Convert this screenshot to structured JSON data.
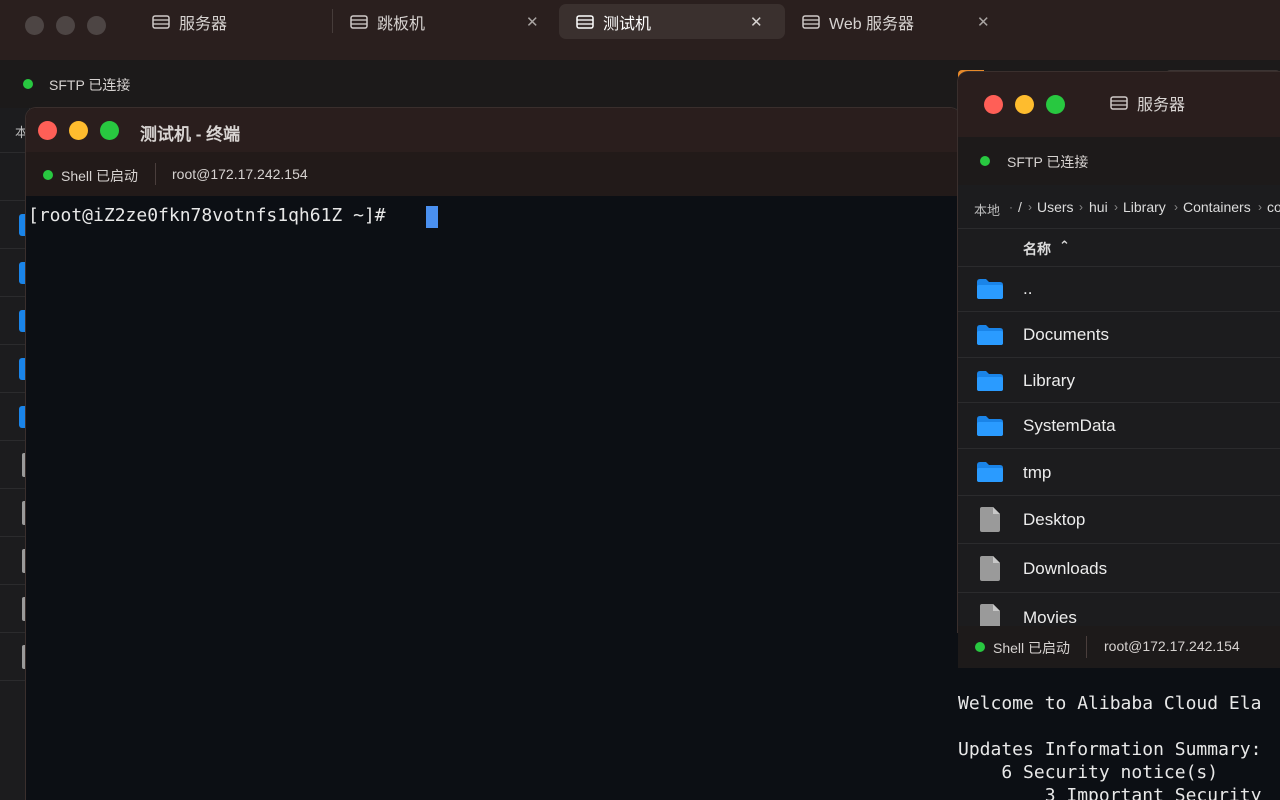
{
  "main_window": {
    "tabs": [
      {
        "label": "服务器",
        "icon": "server-icon",
        "active": false
      },
      {
        "label": "跳板机",
        "icon": "server-icon",
        "active": false
      },
      {
        "label": "测试机",
        "icon": "server-icon",
        "active": true
      },
      {
        "label": "Web 服务器",
        "icon": "server-icon",
        "active": false
      }
    ],
    "close_glyph": "✕",
    "sftp_status": "SFTP 已连接",
    "left_panel_local": "本"
  },
  "terminal": {
    "title": "测试机 - 终端",
    "shell_status": "Shell 已启动",
    "host": "root@172.17.242.154",
    "prompt": "[root@iZ2ze0fkn78votnfs1qh61Z ~]# "
  },
  "file_manager": {
    "title": "服务器",
    "sftp_status": "SFTP 已连接",
    "breadcrumb": [
      "本地",
      "/",
      "Users",
      "hui",
      "Library",
      "Containers",
      "co"
    ],
    "column_name": "名称",
    "sort_glyph": "⌃",
    "items": [
      {
        "name": "..",
        "type": "folder"
      },
      {
        "name": "Documents",
        "type": "folder"
      },
      {
        "name": "Library",
        "type": "folder"
      },
      {
        "name": "SystemData",
        "type": "folder"
      },
      {
        "name": "tmp",
        "type": "folder"
      },
      {
        "name": "Desktop",
        "type": "file"
      },
      {
        "name": "Downloads",
        "type": "file"
      },
      {
        "name": "Movies",
        "type": "file"
      }
    ]
  },
  "bottom_terminal": {
    "shell_status": "Shell 已启动",
    "host": "root@172.17.242.154",
    "lines": [
      "Welcome to Alibaba Cloud Ela",
      "",
      "Updates Information Summary:",
      "    6 Security notice(s)",
      "        3 Important Security"
    ]
  },
  "colors": {
    "status_green": "#28c840",
    "folder_blue": "#1a84e8",
    "cursor_blue": "#4a90f0"
  }
}
